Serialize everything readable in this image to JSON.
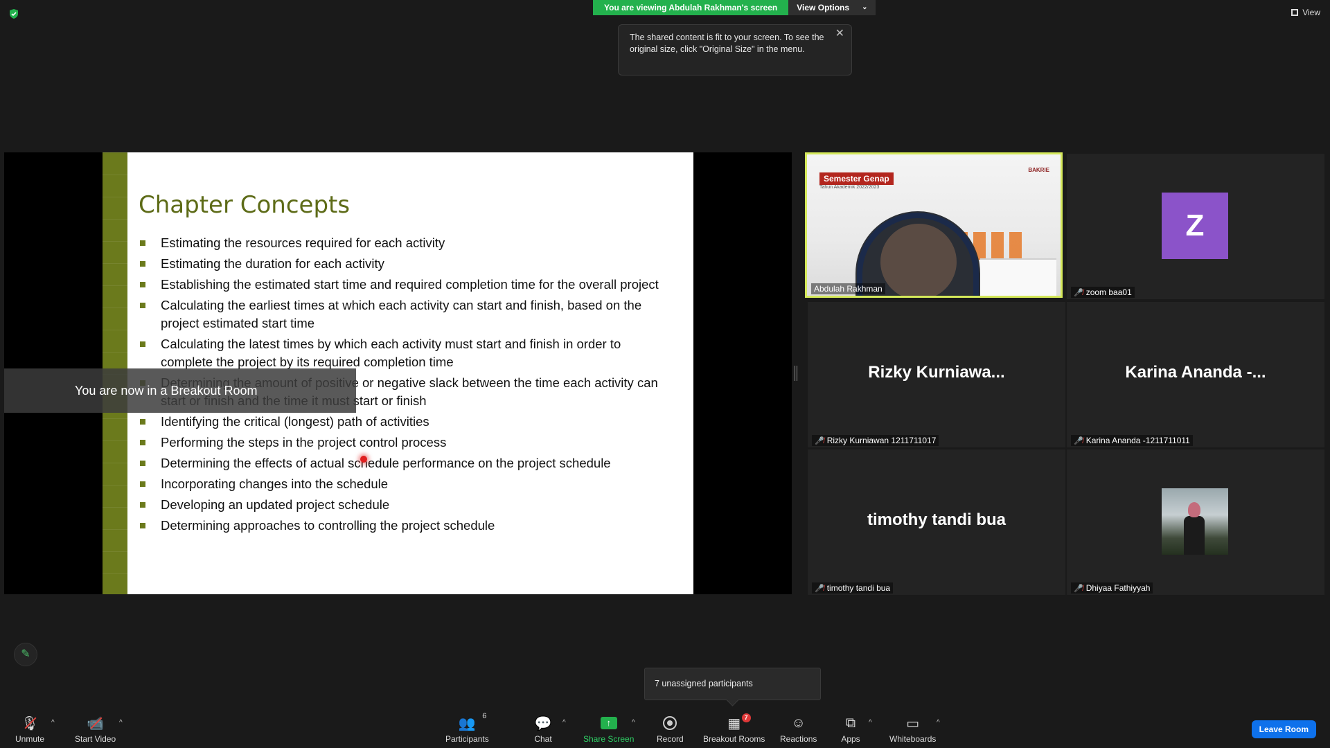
{
  "top": {
    "viewing_label": "You are viewing Abdulah Rakhman's screen",
    "view_options": "View Options",
    "view_button": "View",
    "tooltip": "The shared content is fit to your screen. To see the original size, click \"Original Size\" in the menu."
  },
  "slide": {
    "title": "Chapter Concepts",
    "bullets": [
      "Estimating the resources required for each activity",
      "Estimating the duration for each activity",
      "Establishing the estimated start time and required completion time for the overall project",
      "Calculating the earliest times at which each activity can start and finish, based on the project estimated start time",
      "Calculating the latest times by which each activity must start and finish in order to complete the project by its required completion time",
      "Determining the amount of positive or negative slack between the time each activity can start or finish and the time it must start or finish",
      "Identifying the critical (longest) path of activities",
      "Performing the steps in the project control process",
      "Determining the effects of actual schedule performance on the project schedule",
      "Incorporating changes into the schedule",
      "Developing an updated project schedule",
      "Determining approaches to controlling the project schedule"
    ]
  },
  "breakout_toast": "You are now in a Breakout Room",
  "tiles": {
    "abdulah": {
      "name": "Abdulah Rakhman",
      "banner": "Semester Genap",
      "banner_sub": "Tahun Akademik 2022/2023",
      "logo": "BAKRIE"
    },
    "zoom": {
      "name": "zoom baa01",
      "avatar": "Z"
    },
    "rizky": {
      "big": "Rizky  Kurniawa...",
      "name": "Rizky Kurniawan 1211711017"
    },
    "karina": {
      "big": "Karina Ananda -...",
      "name": "Karina Ananda -1211711011"
    },
    "timothy": {
      "big": "timothy tandi bua",
      "name": "timothy tandi bua"
    },
    "dhiyaa": {
      "name": "Dhiyaa Fathiyyah"
    }
  },
  "unassigned": "7 unassigned participants",
  "toolbar": {
    "unmute": "Unmute",
    "start_video": "Start Video",
    "participants": "Participants",
    "participants_count": "6",
    "chat": "Chat",
    "share_screen": "Share Screen",
    "record": "Record",
    "breakout_rooms": "Breakout Rooms",
    "breakout_badge": "7",
    "reactions": "Reactions",
    "apps": "Apps",
    "whiteboards": "Whiteboards",
    "leave": "Leave Room"
  }
}
